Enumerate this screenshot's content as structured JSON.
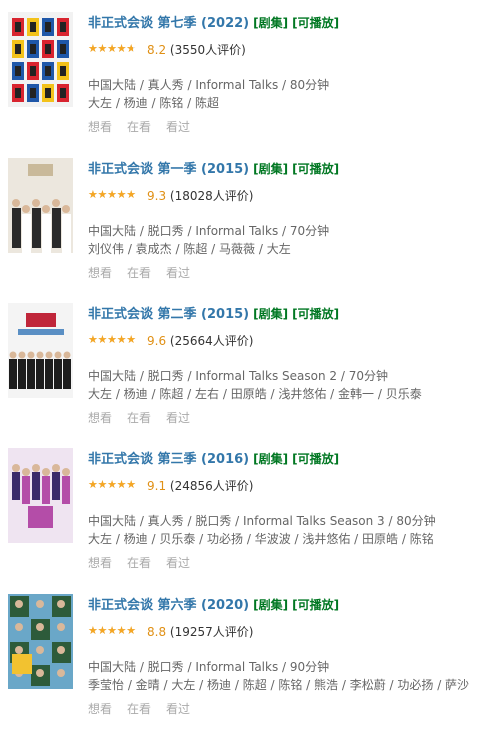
{
  "items": [
    {
      "title": "非正式会谈 第七季 (2022)",
      "tag_series": "[剧集]",
      "tag_playable": "[可播放]",
      "rating": 8.2,
      "score": "8.2",
      "votes": "(3550人评价)",
      "meta": "中国大陆 / 真人秀 / Informal Talks / 80分钟",
      "cast": "大左 / 杨迪 / 陈铭 / 陈超",
      "action_want": "想看",
      "action_doing": "在看",
      "action_done": "看过",
      "poster_colors": [
        "#f2f2f2",
        "#d8242f",
        "#f3c21a",
        "#1f57a8"
      ]
    },
    {
      "title": "非正式会谈 第一季 (2015)",
      "tag_series": "[剧集]",
      "tag_playable": "[可播放]",
      "rating": 9.3,
      "score": "9.3",
      "votes": "(18028人评价)",
      "meta": "中国大陆 / 脱口秀 / Informal Talks / 70分钟",
      "cast": "刘仪伟 / 袁成杰 / 陈超 / 马薇薇 / 大左",
      "action_want": "想看",
      "action_doing": "在看",
      "action_done": "看过",
      "poster_colors": [
        "#ece7de",
        "#ffffff",
        "#2a2a2a",
        "#c9b99a"
      ]
    },
    {
      "title": "非正式会谈 第二季 (2015)",
      "tag_series": "[剧集]",
      "tag_playable": "[可播放]",
      "rating": 9.6,
      "score": "9.6",
      "votes": "(25664人评价)",
      "meta": "中国大陆 / 脱口秀 / Informal Talks Season 2 / 70分钟",
      "cast": "大左 / 杨迪 / 陈超 / 左右 / 田原皓 / 浅井悠佑 / 金韩一 / 贝乐泰",
      "action_want": "想看",
      "action_doing": "在看",
      "action_done": "看过",
      "poster_colors": [
        "#f4f4f4",
        "#c0263a",
        "#1e1e1e",
        "#5a8fc4"
      ]
    },
    {
      "title": "非正式会谈 第三季 (2016)",
      "tag_series": "[剧集]",
      "tag_playable": "[可播放]",
      "rating": 9.1,
      "score": "9.1",
      "votes": "(24856人评价)",
      "meta": "中国大陆 / 真人秀 / 脱口秀 / Informal Talks Season 3 / 80分钟",
      "cast": "大左 / 杨迪 / 贝乐泰 / 功必扬 / 华波波 / 浅井悠佑 / 田原皓 / 陈铭",
      "action_want": "想看",
      "action_doing": "在看",
      "action_done": "看过",
      "poster_colors": [
        "#efe4f1",
        "#b44da8",
        "#3a2a6a",
        "#f2f2f2"
      ]
    },
    {
      "title": "非正式会谈 第六季 (2020)",
      "tag_series": "[剧集]",
      "tag_playable": "[可播放]",
      "rating": 8.8,
      "score": "8.8",
      "votes": "(19257人评价)",
      "meta": "中国大陆 / 脱口秀 / Informal Talks / 90分钟",
      "cast": "季莹怡 / 金晴 / 大左 / 杨迪 / 陈超 / 陈铭 / 熊浩 / 李松蔚 / 功必扬 / 萨沙",
      "action_want": "想看",
      "action_doing": "在看",
      "action_done": "看过",
      "poster_colors": [
        "#6aa7c8",
        "#f2c230",
        "#2d5b3a",
        "#ffffff"
      ]
    }
  ]
}
